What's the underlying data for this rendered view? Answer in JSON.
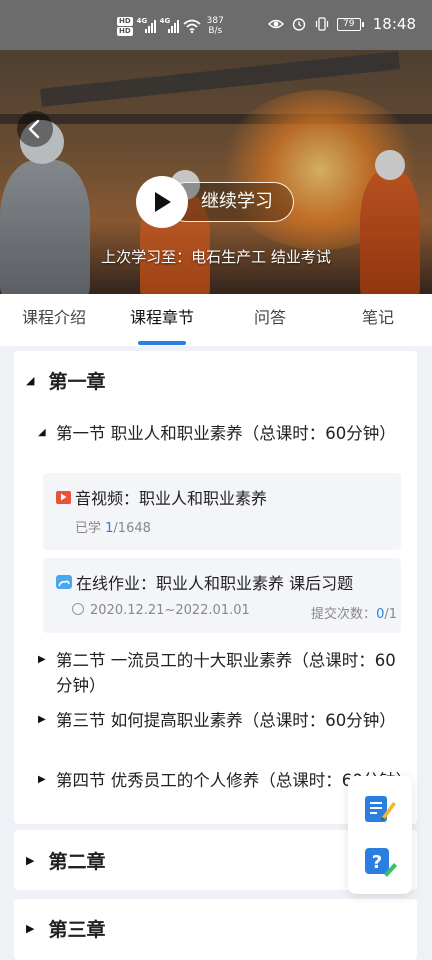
{
  "status_bar": {
    "hd_top": "HD",
    "hd_bottom": "HD",
    "sig1": "4G",
    "sig2": "4G",
    "speed_value": "387",
    "speed_unit": "B/s",
    "battery": "79",
    "time": "18:48"
  },
  "hero": {
    "continue_label": "继续学习",
    "last_learned": "上次学习至：电石生产工 结业考试"
  },
  "tabs": [
    {
      "label": "课程介绍",
      "active": false
    },
    {
      "label": "课程章节",
      "active": true
    },
    {
      "label": "问答",
      "active": false
    },
    {
      "label": "笔记",
      "active": false
    }
  ],
  "chapters": [
    {
      "title": "第一章",
      "expanded": true,
      "sections": [
        {
          "title": "第一节 职业人和职业素养（总课时：60分钟）",
          "expanded": true,
          "lessons": [
            {
              "type": "video",
              "title": "音视频：职业人和职业素养",
              "progress_prefix": "已学 ",
              "progress_done": "1",
              "progress_total": "/1648"
            },
            {
              "type": "homework",
              "title": "在线作业：职业人和职业素养 课后习题",
              "date_range": "2020.12.21~2022.01.01",
              "submit_label": "提交次数：",
              "submit_count": "0",
              "submit_total": "/1"
            }
          ]
        },
        {
          "title": "第二节 一流员工的十大职业素养（总课时：60分钟）",
          "expanded": false
        },
        {
          "title": "第三节 如何提高职业素养（总课时：60分钟）",
          "expanded": false
        },
        {
          "title": "第四节 优秀员工的个人修养（总课时：60分钟）",
          "expanded": false
        }
      ]
    },
    {
      "title": "第二章",
      "expanded": false
    },
    {
      "title": "第三章",
      "expanded": false
    }
  ],
  "icons": {
    "back": "chevron-left-icon",
    "play": "play-icon",
    "note_fab": "note-edit-icon",
    "question_fab": "question-edit-icon"
  },
  "colors": {
    "accent": "#2a7fe0",
    "video_icon": "#e8543a",
    "homework_icon": "#4aa9ec"
  }
}
